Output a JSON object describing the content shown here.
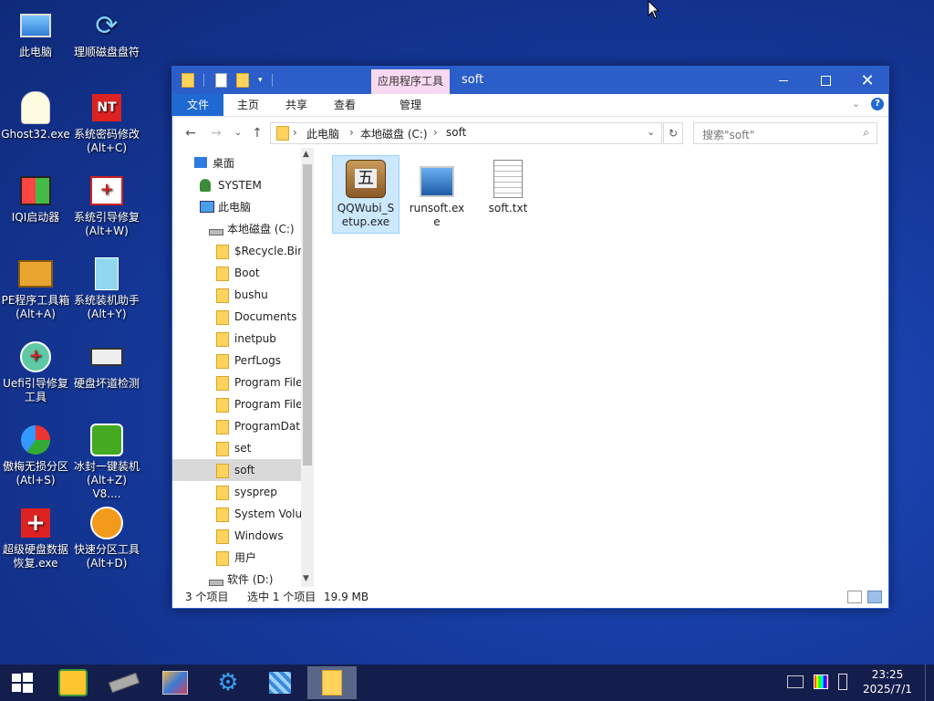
{
  "desktop": {
    "icons": [
      {
        "label": "此电脑",
        "icon": "computer-icon"
      },
      {
        "label": "理顺磁盘盘符",
        "icon": "refresh-arrows-icon"
      },
      {
        "label": "Ghost32.exe",
        "icon": "ghost-icon"
      },
      {
        "label": "系统密码修改\n(Alt+C)",
        "icon": "password-key-icon"
      },
      {
        "label": "IQI启动器",
        "icon": "windows-flag-icon"
      },
      {
        "label": "系统引导修复\n(Alt+W)",
        "icon": "first-aid-box-icon"
      },
      {
        "label": "PE程序工具箱\n(Alt+A)",
        "icon": "toolbox-icon"
      },
      {
        "label": "系统装机助手\n(Alt+Y)",
        "icon": "install-helper-icon"
      },
      {
        "label": "Uefi引导修复\n工具",
        "icon": "uefi-repair-icon"
      },
      {
        "label": "硬盘坏道检测",
        "icon": "hard-disk-icon"
      },
      {
        "label": "傲梅无损分区\n(Atl+S)",
        "icon": "partition-pie-icon"
      },
      {
        "label": "冰封一键装机\n(Alt+Z) V8....",
        "icon": "green-ghost-icon"
      },
      {
        "label": "超级硬盘数据\n恢复.exe",
        "icon": "red-cross-icon"
      },
      {
        "label": "快速分区工具\n(Alt+D)",
        "icon": "diskgenius-icon"
      }
    ]
  },
  "window": {
    "title": "soft",
    "context_tab": "应用程序工具",
    "ribbon_tabs": [
      "文件",
      "主页",
      "共享",
      "查看",
      "管理"
    ],
    "address": {
      "crumbs": [
        "此电脑",
        "本地磁盘 (C:)",
        "soft"
      ]
    },
    "search": {
      "placeholder": "搜索\"soft\""
    },
    "nav_tree": [
      {
        "label": "桌面",
        "icon": "desktop-icon"
      },
      {
        "label": "SYSTEM",
        "icon": "user-icon"
      },
      {
        "label": "此电脑",
        "icon": "computer-icon"
      },
      {
        "label": "本地磁盘 (C:)",
        "icon": "drive-icon"
      },
      {
        "label": "$Recycle.Bin",
        "icon": "folder-icon"
      },
      {
        "label": "Boot",
        "icon": "folder-icon"
      },
      {
        "label": "bushu",
        "icon": "folder-icon"
      },
      {
        "label": "Documents a",
        "icon": "folder-icon"
      },
      {
        "label": "inetpub",
        "icon": "folder-icon"
      },
      {
        "label": "PerfLogs",
        "icon": "folder-icon"
      },
      {
        "label": "Program File",
        "icon": "folder-icon"
      },
      {
        "label": "Program File",
        "icon": "folder-icon"
      },
      {
        "label": "ProgramDat",
        "icon": "folder-icon"
      },
      {
        "label": "set",
        "icon": "folder-icon"
      },
      {
        "label": "soft",
        "icon": "folder-icon",
        "selected": true
      },
      {
        "label": "sysprep",
        "icon": "folder-icon"
      },
      {
        "label": "System Volu",
        "icon": "folder-icon"
      },
      {
        "label": "Windows",
        "icon": "folder-icon"
      },
      {
        "label": "用户",
        "icon": "folder-icon"
      },
      {
        "label": "软件 (D:)",
        "icon": "drive-icon"
      }
    ],
    "files": [
      {
        "name": "QQWubi_S\netup.exe",
        "icon": "wubi-installer-icon",
        "selected": true
      },
      {
        "name": "runsoft.ex\ne",
        "icon": "runsoft-icon",
        "selected": false
      },
      {
        "name": "soft.txt",
        "icon": "text-file-icon",
        "selected": false
      }
    ],
    "status": {
      "count": "3 个项目",
      "selection": "选中 1 个项目",
      "size": "19.9 MB"
    }
  },
  "taskbar": {
    "time": "23:25",
    "date": "2025/7/1",
    "apps": [
      "start-icon",
      "pe-tools-icon",
      "memory-icon",
      "picture-tool-icon",
      "gears-icon",
      "network-icon",
      "file-explorer-icon"
    ]
  },
  "colors": {
    "titlebar": "#2b5ec8",
    "file_tab": "#1e69d2",
    "selection": "#cce8ff",
    "taskbar": "#141e4d"
  }
}
